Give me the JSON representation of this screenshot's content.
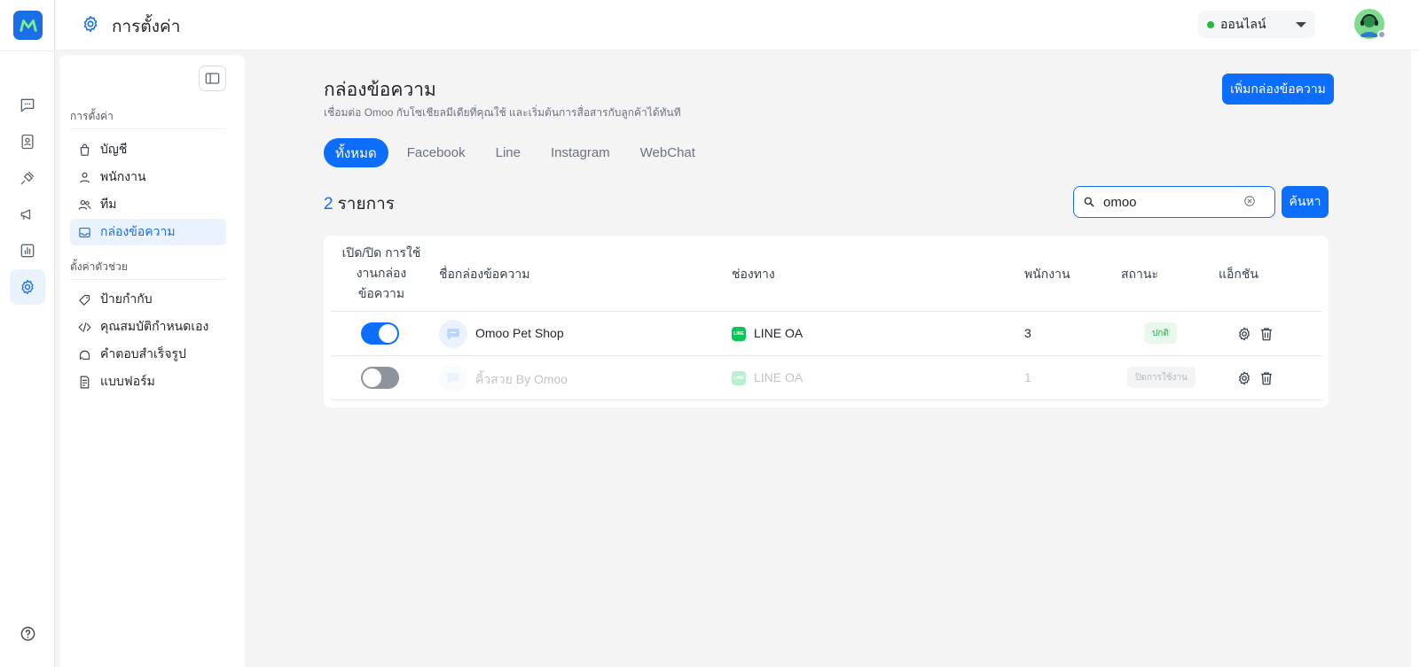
{
  "header": {
    "title": "การตั้งค่า",
    "status": "ออนไลน์"
  },
  "sidebar": {
    "section1": "การตั้งค่า",
    "items1": [
      {
        "label": "บัญชี",
        "icon": "bag-icon"
      },
      {
        "label": "พนักงาน",
        "icon": "user-icon"
      },
      {
        "label": "ทีม",
        "icon": "users-icon"
      },
      {
        "label": "กล่องข้อความ",
        "icon": "inbox-icon"
      }
    ],
    "section2": "ตั้งค่าตัวช่วย",
    "items2": [
      {
        "label": "ป้ายกำกับ",
        "icon": "tag-icon"
      },
      {
        "label": "คุณสมบัติกำหนดเอง",
        "icon": "code-icon"
      },
      {
        "label": "คำตอบสำเร็จรูป",
        "icon": "chat-reply-icon"
      },
      {
        "label": "แบบฟอร์ม",
        "icon": "form-icon"
      }
    ]
  },
  "main": {
    "title": "กล่องข้อความ",
    "subtitle": "เชื่อมต่อ Omoo กับโซเชียลมีเดียที่คุณใช้ และเริ่มต้นการสื่อสารกับลูกค้าได้ทันที",
    "add_button": "เพิ่มกล่องข้อความ",
    "tabs": [
      "ทั้งหมด",
      "Facebook",
      "Line",
      "Instagram",
      "WebChat"
    ],
    "count_number": "2",
    "count_label": "รายการ",
    "search": {
      "value": "omoo",
      "button": "ค้นหา"
    },
    "table": {
      "headers": {
        "toggle": "เปิด/ปิด การใช้งานกล่องข้อความ",
        "name": "ชื่อกล่องข้อความ",
        "channel": "ช่องทาง",
        "staff": "พนักงาน",
        "status": "สถานะ",
        "action": "แอ็กชัน"
      },
      "rows": [
        {
          "enabled": true,
          "name": "Omoo Pet Shop",
          "channel": "LINE OA",
          "staff": "3",
          "status": "ปกติ"
        },
        {
          "enabled": false,
          "name": "คิ้วสวย By Omoo",
          "channel": "LINE OA",
          "staff": "1",
          "status": "ปิดการใช้งาน"
        }
      ]
    }
  },
  "colors": {
    "primary": "#0d6efd",
    "online": "#1fbe3c",
    "line": "#06c755"
  }
}
